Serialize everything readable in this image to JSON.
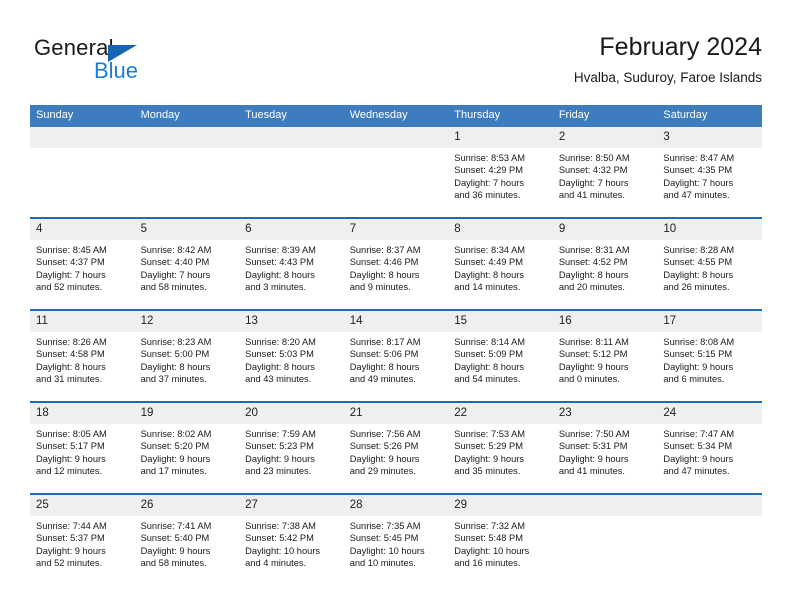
{
  "brand": {
    "name_part1": "General",
    "name_part2": "Blue",
    "triangle_icon": "triangle-icon",
    "accent_color": "#1a7fd4",
    "logo_dark_color": "#1a1a1a"
  },
  "header": {
    "title": "February 2024",
    "subtitle": "Hvalba, Suduroy, Faroe Islands",
    "header_bar_color": "#3d7cbf",
    "row_divider_color": "#1f6cb0",
    "daynum_band_color": "#efefef"
  },
  "weekdays": [
    "Sunday",
    "Monday",
    "Tuesday",
    "Wednesday",
    "Thursday",
    "Friday",
    "Saturday"
  ],
  "weeks": [
    [
      {
        "day": "",
        "sunrise": "",
        "sunset": "",
        "daylight_line1": "",
        "daylight_line2": ""
      },
      {
        "day": "",
        "sunrise": "",
        "sunset": "",
        "daylight_line1": "",
        "daylight_line2": ""
      },
      {
        "day": "",
        "sunrise": "",
        "sunset": "",
        "daylight_line1": "",
        "daylight_line2": ""
      },
      {
        "day": "",
        "sunrise": "",
        "sunset": "",
        "daylight_line1": "",
        "daylight_line2": ""
      },
      {
        "day": "1",
        "sunrise": "Sunrise: 8:53 AM",
        "sunset": "Sunset: 4:29 PM",
        "daylight_line1": "Daylight: 7 hours",
        "daylight_line2": "and 36 minutes."
      },
      {
        "day": "2",
        "sunrise": "Sunrise: 8:50 AM",
        "sunset": "Sunset: 4:32 PM",
        "daylight_line1": "Daylight: 7 hours",
        "daylight_line2": "and 41 minutes."
      },
      {
        "day": "3",
        "sunrise": "Sunrise: 8:47 AM",
        "sunset": "Sunset: 4:35 PM",
        "daylight_line1": "Daylight: 7 hours",
        "daylight_line2": "and 47 minutes."
      }
    ],
    [
      {
        "day": "4",
        "sunrise": "Sunrise: 8:45 AM",
        "sunset": "Sunset: 4:37 PM",
        "daylight_line1": "Daylight: 7 hours",
        "daylight_line2": "and 52 minutes."
      },
      {
        "day": "5",
        "sunrise": "Sunrise: 8:42 AM",
        "sunset": "Sunset: 4:40 PM",
        "daylight_line1": "Daylight: 7 hours",
        "daylight_line2": "and 58 minutes."
      },
      {
        "day": "6",
        "sunrise": "Sunrise: 8:39 AM",
        "sunset": "Sunset: 4:43 PM",
        "daylight_line1": "Daylight: 8 hours",
        "daylight_line2": "and 3 minutes."
      },
      {
        "day": "7",
        "sunrise": "Sunrise: 8:37 AM",
        "sunset": "Sunset: 4:46 PM",
        "daylight_line1": "Daylight: 8 hours",
        "daylight_line2": "and 9 minutes."
      },
      {
        "day": "8",
        "sunrise": "Sunrise: 8:34 AM",
        "sunset": "Sunset: 4:49 PM",
        "daylight_line1": "Daylight: 8 hours",
        "daylight_line2": "and 14 minutes."
      },
      {
        "day": "9",
        "sunrise": "Sunrise: 8:31 AM",
        "sunset": "Sunset: 4:52 PM",
        "daylight_line1": "Daylight: 8 hours",
        "daylight_line2": "and 20 minutes."
      },
      {
        "day": "10",
        "sunrise": "Sunrise: 8:28 AM",
        "sunset": "Sunset: 4:55 PM",
        "daylight_line1": "Daylight: 8 hours",
        "daylight_line2": "and 26 minutes."
      }
    ],
    [
      {
        "day": "11",
        "sunrise": "Sunrise: 8:26 AM",
        "sunset": "Sunset: 4:58 PM",
        "daylight_line1": "Daylight: 8 hours",
        "daylight_line2": "and 31 minutes."
      },
      {
        "day": "12",
        "sunrise": "Sunrise: 8:23 AM",
        "sunset": "Sunset: 5:00 PM",
        "daylight_line1": "Daylight: 8 hours",
        "daylight_line2": "and 37 minutes."
      },
      {
        "day": "13",
        "sunrise": "Sunrise: 8:20 AM",
        "sunset": "Sunset: 5:03 PM",
        "daylight_line1": "Daylight: 8 hours",
        "daylight_line2": "and 43 minutes."
      },
      {
        "day": "14",
        "sunrise": "Sunrise: 8:17 AM",
        "sunset": "Sunset: 5:06 PM",
        "daylight_line1": "Daylight: 8 hours",
        "daylight_line2": "and 49 minutes."
      },
      {
        "day": "15",
        "sunrise": "Sunrise: 8:14 AM",
        "sunset": "Sunset: 5:09 PM",
        "daylight_line1": "Daylight: 8 hours",
        "daylight_line2": "and 54 minutes."
      },
      {
        "day": "16",
        "sunrise": "Sunrise: 8:11 AM",
        "sunset": "Sunset: 5:12 PM",
        "daylight_line1": "Daylight: 9 hours",
        "daylight_line2": "and 0 minutes."
      },
      {
        "day": "17",
        "sunrise": "Sunrise: 8:08 AM",
        "sunset": "Sunset: 5:15 PM",
        "daylight_line1": "Daylight: 9 hours",
        "daylight_line2": "and 6 minutes."
      }
    ],
    [
      {
        "day": "18",
        "sunrise": "Sunrise: 8:05 AM",
        "sunset": "Sunset: 5:17 PM",
        "daylight_line1": "Daylight: 9 hours",
        "daylight_line2": "and 12 minutes."
      },
      {
        "day": "19",
        "sunrise": "Sunrise: 8:02 AM",
        "sunset": "Sunset: 5:20 PM",
        "daylight_line1": "Daylight: 9 hours",
        "daylight_line2": "and 17 minutes."
      },
      {
        "day": "20",
        "sunrise": "Sunrise: 7:59 AM",
        "sunset": "Sunset: 5:23 PM",
        "daylight_line1": "Daylight: 9 hours",
        "daylight_line2": "and 23 minutes."
      },
      {
        "day": "21",
        "sunrise": "Sunrise: 7:56 AM",
        "sunset": "Sunset: 5:26 PM",
        "daylight_line1": "Daylight: 9 hours",
        "daylight_line2": "and 29 minutes."
      },
      {
        "day": "22",
        "sunrise": "Sunrise: 7:53 AM",
        "sunset": "Sunset: 5:29 PM",
        "daylight_line1": "Daylight: 9 hours",
        "daylight_line2": "and 35 minutes."
      },
      {
        "day": "23",
        "sunrise": "Sunrise: 7:50 AM",
        "sunset": "Sunset: 5:31 PM",
        "daylight_line1": "Daylight: 9 hours",
        "daylight_line2": "and 41 minutes."
      },
      {
        "day": "24",
        "sunrise": "Sunrise: 7:47 AM",
        "sunset": "Sunset: 5:34 PM",
        "daylight_line1": "Daylight: 9 hours",
        "daylight_line2": "and 47 minutes."
      }
    ],
    [
      {
        "day": "25",
        "sunrise": "Sunrise: 7:44 AM",
        "sunset": "Sunset: 5:37 PM",
        "daylight_line1": "Daylight: 9 hours",
        "daylight_line2": "and 52 minutes."
      },
      {
        "day": "26",
        "sunrise": "Sunrise: 7:41 AM",
        "sunset": "Sunset: 5:40 PM",
        "daylight_line1": "Daylight: 9 hours",
        "daylight_line2": "and 58 minutes."
      },
      {
        "day": "27",
        "sunrise": "Sunrise: 7:38 AM",
        "sunset": "Sunset: 5:42 PM",
        "daylight_line1": "Daylight: 10 hours",
        "daylight_line2": "and 4 minutes."
      },
      {
        "day": "28",
        "sunrise": "Sunrise: 7:35 AM",
        "sunset": "Sunset: 5:45 PM",
        "daylight_line1": "Daylight: 10 hours",
        "daylight_line2": "and 10 minutes."
      },
      {
        "day": "29",
        "sunrise": "Sunrise: 7:32 AM",
        "sunset": "Sunset: 5:48 PM",
        "daylight_line1": "Daylight: 10 hours",
        "daylight_line2": "and 16 minutes."
      },
      {
        "day": "",
        "sunrise": "",
        "sunset": "",
        "daylight_line1": "",
        "daylight_line2": ""
      },
      {
        "day": "",
        "sunrise": "",
        "sunset": "",
        "daylight_line1": "",
        "daylight_line2": ""
      }
    ]
  ]
}
